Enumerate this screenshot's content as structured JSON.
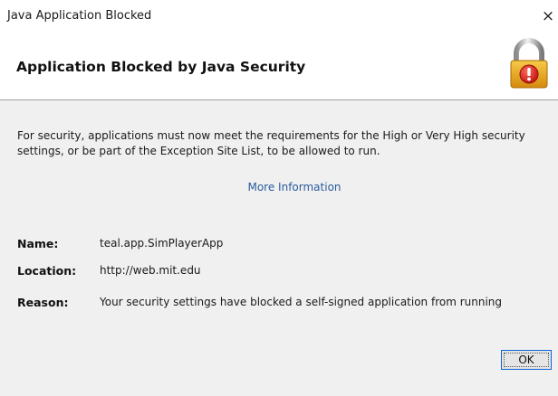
{
  "window": {
    "title": "Java Application Blocked",
    "close_glyph": "×"
  },
  "header": {
    "title": "Application Blocked by Java Security",
    "icon": "padlock-warning-icon"
  },
  "content": {
    "message": "For security, applications must now meet the requirements for the High or Very High security settings, or be part of the Exception Site List, to be allowed to run.",
    "more_info_link": "More Information",
    "fields": {
      "name_label": "Name:",
      "name_value": "teal.app.SimPlayerApp",
      "location_label": "Location:",
      "location_value": "http://web.mit.edu",
      "reason_label": "Reason:",
      "reason_value": "Your security settings have blocked a self-signed application from running"
    }
  },
  "buttons": {
    "ok_label": "OK"
  },
  "colors": {
    "link": "#2a5b9e",
    "body_background": "#f0f0f0",
    "button_focus_border": "#0a64d6",
    "lock_body": "#e6a817",
    "warning_badge": "#d42020"
  }
}
